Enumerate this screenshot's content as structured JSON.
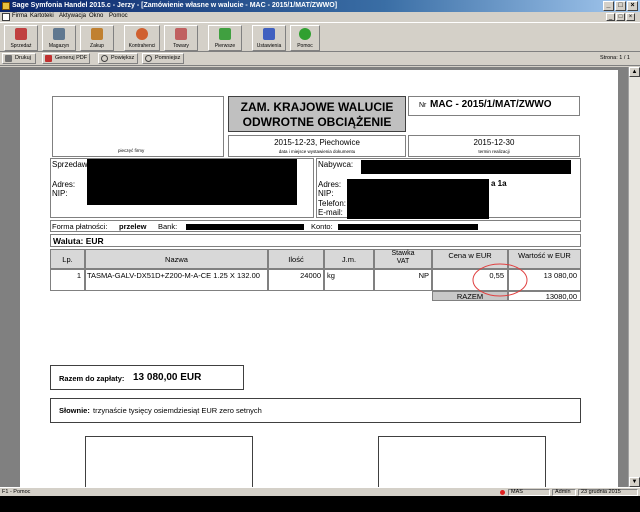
{
  "window": {
    "title": "Sage Symfonia Handel 2015.c - Jerzy - [Zamówienie własne w walucie - MAC - 2015/1/MAT/ZWWO]",
    "controls": [
      "_",
      "□",
      "×"
    ]
  },
  "menu": [
    "Firma",
    "Kartoteki",
    "Aktywacja",
    "Okno",
    "Pomoc"
  ],
  "toolbar": {
    "sprzedaz": "Sprzedaż",
    "magazyn": "Magazyn",
    "zakup": "Zakup",
    "kontrahenci": "Kontrahenci",
    "towary": "Towary",
    "pierwszy": "Pierwsze kroki",
    "ustawienia": "Ustawienia",
    "pomoc": "Pomoc",
    "pierwsze_label": "Pierwsze"
  },
  "preview_toolbar": {
    "drukuj": "Drukuj",
    "pdf": "Generuj PDF",
    "powieksz": "Powiększ",
    "pomniejsz": "Pomniejsz",
    "page_info": "Strona: 1 / 1"
  },
  "document": {
    "stamp_label": "pieczęć firmy",
    "title_line1": "ZAM. KRAJOWE WALUCIE",
    "title_line2": "ODWROTNE OBCIĄŻENIE",
    "nr_label": "Nr",
    "nr_value": "MAC - 2015/1/MAT/ZWWO",
    "issue_date": "2015-12-23, Piechowice",
    "issue_caption": "data i miejsce wystawienia dokumentu",
    "due_date": "2015-12-30",
    "due_caption": "termin realizacji",
    "seller_label": "Sprzedawca:",
    "address_label": "Adres:",
    "nip_label": "NIP:",
    "buyer_label": "Nabywca:",
    "buyer_addr_label": "Adres:",
    "buyer_nip_label": "NIP:",
    "phone_label": "Telefon:",
    "email_label": "E-mail:",
    "buyer_addr_tail": "a 1a",
    "payment_label": "Forma płatności:",
    "payment_value": "przelew",
    "bank_label": "Bank:",
    "konto_label": "Konto:",
    "currency_label": "Waluta: EUR",
    "headers": [
      "Lp.",
      "Nazwa",
      "Ilość",
      "J.m.",
      "Stawka VAT",
      "Cena w EUR",
      "Wartość w EUR"
    ],
    "rows": [
      {
        "lp": "1",
        "nazwa": "TASMA-GALV-DX51D+Z200-M-A-CE 1.25 X 132.00",
        "ilosc": "24000",
        "jm": "kg",
        "vat": "NP",
        "cena": "0,55",
        "wartosc": "13 080,00"
      }
    ],
    "razem_label": "RAZEM",
    "razem_value": "13080,00",
    "to_pay_label": "Razem do zapłaty:",
    "to_pay_value": "13 080,00 EUR",
    "words_label": "Słownie:",
    "words_value": "trzynaście tysięcy osiemdziesiąt EUR zero setnych"
  },
  "status": {
    "hint": "F1 - Pomoc",
    "company": "MAS",
    "user": "Admin",
    "date": "23 grudnia 2015"
  },
  "colors": {
    "title_start": "#0a246a",
    "annotation": "#e04040"
  }
}
